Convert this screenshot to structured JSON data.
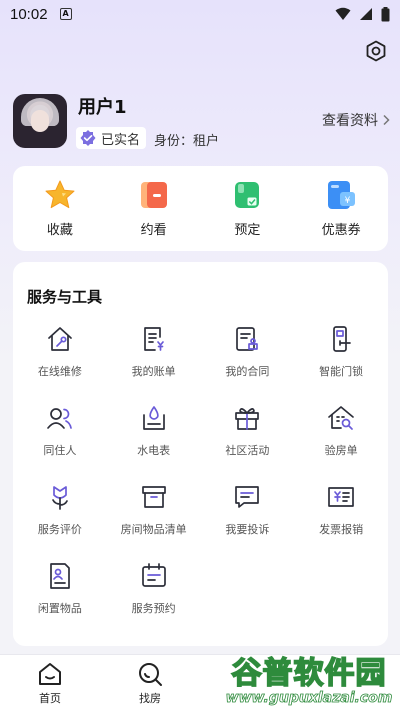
{
  "status_bar": {
    "time": "10:02",
    "app_icon": "A"
  },
  "profile": {
    "name": "用户1",
    "verified_label": "已实名",
    "identity_label": "身份：租户",
    "view_link": "查看资料"
  },
  "quick_actions": [
    {
      "label": "收藏",
      "icon": "star-icon"
    },
    {
      "label": "约看",
      "icon": "appointment-card-icon"
    },
    {
      "label": "预定",
      "icon": "reserve-wallet-icon"
    },
    {
      "label": "优惠券",
      "icon": "coupon-icon"
    }
  ],
  "services": {
    "title": "服务与工具",
    "items": [
      {
        "label": "在线维修",
        "icon": "repair-house-icon"
      },
      {
        "label": "我的账单",
        "icon": "bill-icon"
      },
      {
        "label": "我的合同",
        "icon": "contract-icon"
      },
      {
        "label": "智能门锁",
        "icon": "smart-lock-icon"
      },
      {
        "label": "同住人",
        "icon": "roommates-icon"
      },
      {
        "label": "水电表",
        "icon": "utility-meter-icon"
      },
      {
        "label": "社区活动",
        "icon": "gift-icon"
      },
      {
        "label": "验房单",
        "icon": "house-inspection-icon"
      },
      {
        "label": "服务评价",
        "icon": "flower-rating-icon"
      },
      {
        "label": "房间物品清单",
        "icon": "storage-box-icon"
      },
      {
        "label": "我要投诉",
        "icon": "complaint-chat-icon"
      },
      {
        "label": "发票报销",
        "icon": "invoice-icon"
      },
      {
        "label": "闲置物品",
        "icon": "idle-items-icon"
      },
      {
        "label": "服务预约",
        "icon": "calendar-icon"
      }
    ]
  },
  "bottom_nav": [
    {
      "label": "首页",
      "icon": "home-icon"
    },
    {
      "label": "找房",
      "icon": "search-icon"
    }
  ],
  "watermark": {
    "title": "谷普软件园",
    "url": "www.gupuxlazai.com"
  },
  "colors": {
    "accent": "#6a5bd8",
    "icon_line": "#2d2f3a",
    "background": "#f3f3f8"
  }
}
